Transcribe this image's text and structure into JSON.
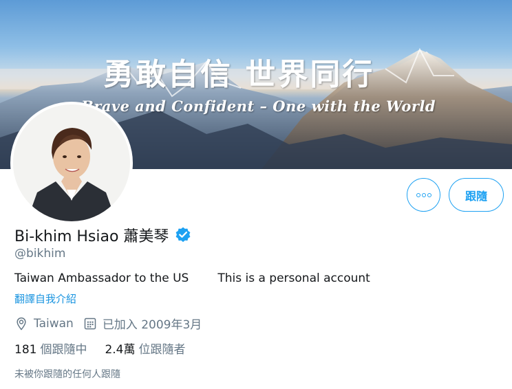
{
  "banner": {
    "title_cn": "勇敢自信 世界同行",
    "title_en": "Brave and Confident – One with the World"
  },
  "profile": {
    "display_name": "Bi-khim Hsiao 蕭美琴",
    "handle": "@bikhim",
    "verified": true,
    "bio_part1": "Taiwan Ambassador to the US",
    "bio_part2": "This is a personal account",
    "translate_link": "翻譯自我介紹",
    "location": "Taiwan",
    "joined": "已加入 2009年3月",
    "following_count": "181",
    "following_label": "個跟隨中",
    "followers_count": "2.4萬",
    "followers_label": "位跟隨者",
    "followed_by_note": "未被你跟隨的任何人跟隨"
  },
  "actions": {
    "follow_label": "跟隨",
    "more_icon": "more-dots-icon"
  },
  "colors": {
    "accent": "#1da1f2",
    "link": "#1b95e0",
    "secondary_text": "#657786",
    "primary_text": "#14171a"
  }
}
